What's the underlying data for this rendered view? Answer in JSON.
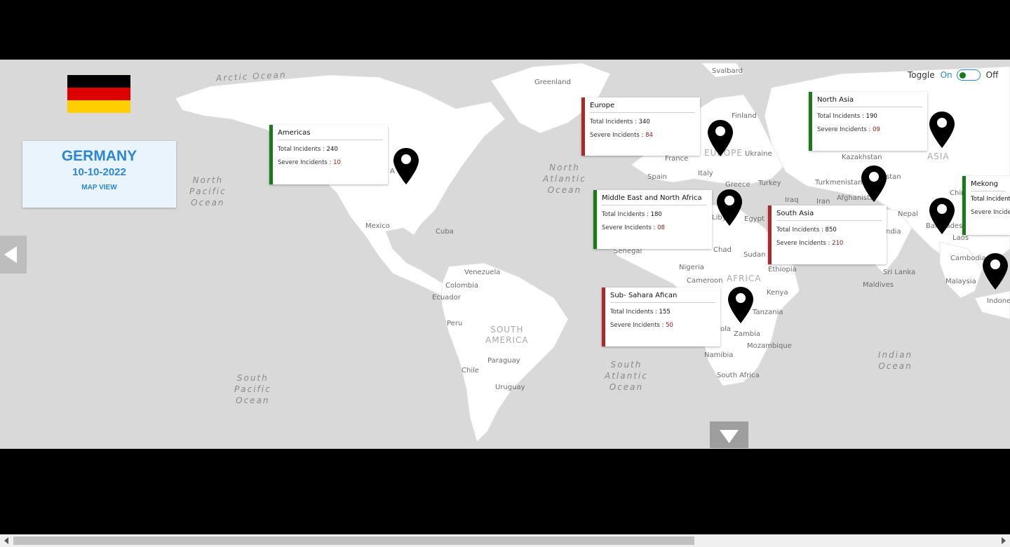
{
  "header": {
    "country": "GERMANY",
    "date": "10-10-2022",
    "view": "MAP VIEW",
    "flag_colors": [
      "#000000",
      "#dd0000",
      "#ffce00"
    ]
  },
  "toggle": {
    "label": "Toggle",
    "on": "On",
    "off": "Off",
    "state": "on"
  },
  "labels": {
    "total": "Total Incidents :",
    "severe": "Severe Incidents :"
  },
  "regions": [
    {
      "name": "Americas",
      "total": "240",
      "severe": "10",
      "status": "green"
    },
    {
      "name": "Europe",
      "total": "340",
      "severe": "84",
      "status": "red"
    },
    {
      "name": "North Asia",
      "total": "190",
      "severe": "09",
      "status": "green"
    },
    {
      "name": "Middle East  and North Africa",
      "total": "180",
      "severe": "08",
      "status": "green"
    },
    {
      "name": "South Asia",
      "total": "850",
      "severe": "210",
      "status": "red"
    },
    {
      "name": "Sub- Sahara Afican",
      "total": "155",
      "severe": "50",
      "status": "red"
    },
    {
      "name": "Mekong",
      "total": "Total Incident",
      "severe": "Severe Incide",
      "status": "green"
    }
  ],
  "oceans": {
    "arctic": "Arctic Ocean",
    "north_pacific": [
      "North",
      "Pacific",
      "Ocean"
    ],
    "north_atlantic": [
      "North",
      "Atlantic",
      "Ocean"
    ],
    "south_pacific": [
      "South",
      "Pacific",
      "Ocean"
    ],
    "south_atlantic": [
      "South",
      "Atlantic",
      "Ocean"
    ],
    "indian": [
      "Indian",
      "Ocean"
    ]
  },
  "continents": {
    "south_america": [
      "SOUTH",
      "AMERICA"
    ],
    "europe": "EUROPE",
    "asia": "ASIA",
    "africa": "AFRICA"
  },
  "places": {
    "greenland": "Greenland",
    "svalbard": "Svalbard",
    "finland": "Finland",
    "ukraine": "Ukraine",
    "france": "France",
    "spain": "Spain",
    "italy": "Italy",
    "greece": "Greece",
    "turkey": "Turkey",
    "kazakhstan": "Kazakhstan",
    "turkmenistan": "Turkmenistan",
    "afghanistan": "Afghanista",
    "iraq": "Iraq",
    "iran": "Iran",
    "egypt": "Egypt",
    "libya": "Liby",
    "chad": "Chad",
    "sudan": "Sudan",
    "senegal": "Senegal",
    "nigeria": "Nigeria",
    "ethiopia": "Ethiopia",
    "cameroon": "Cameroon",
    "kenya": "Kenya",
    "tanzania": "Tanzania",
    "zambia": "Zambia",
    "angola": "ola",
    "mozambique": "Mozambique",
    "namibia": "Namibia",
    "south_africa": "South Africa",
    "nepal": "Nepal",
    "bangladesh": "Banglades",
    "india": "ndia",
    "sri_lanka": "Sri Lanka",
    "maldives": "Maldives",
    "laos": "Laos",
    "cambodia": "Cambodia",
    "malaysia": "Malaysia",
    "indonesia": "Indones",
    "china": "Chin",
    "stan": "stan",
    "mexico": "Mexico",
    "cuba": "Cuba",
    "venezuela": "Venezuela",
    "colombia": "Colombia",
    "ecuador": "Ecuador",
    "peru": "Peru",
    "paraguay": "Paraguay",
    "chile": "Chile",
    "uruguay": "Uruguay",
    "usa_partial": "A"
  },
  "icons": {
    "pin": "map-pin-icon",
    "left": "arrow-left-icon",
    "down": "arrow-down-icon"
  }
}
